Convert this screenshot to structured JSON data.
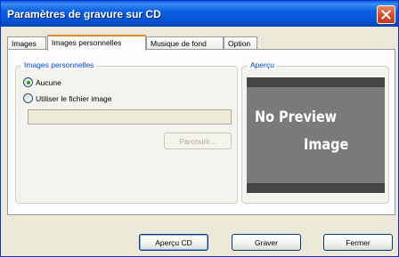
{
  "window": {
    "title": "Paramètres de gravure sur CD"
  },
  "tabs": [
    {
      "label": "Images",
      "active": false
    },
    {
      "label": "Images personnelles",
      "active": true
    },
    {
      "label": "Musique de fond",
      "active": false
    },
    {
      "label": "Option",
      "active": false
    }
  ],
  "personal_images": {
    "group_label": "Images personnelles",
    "options": [
      {
        "label": "Aucune",
        "checked": true
      },
      {
        "label": "Utiliser le fichier image",
        "checked": false
      }
    ],
    "file_path_value": "",
    "browse_label": "Parcourir..."
  },
  "preview": {
    "group_label": "Aperçu",
    "placeholder_line1": "No Preview",
    "placeholder_line2": "Image"
  },
  "footer": {
    "preview_button": "Aperçu CD",
    "burn_button": "Graver",
    "close_button": "Fermer"
  },
  "colors": {
    "title_bar": "#0556d8",
    "group_label": "#0046d5",
    "active_tab_accent": "#e68b2c"
  }
}
